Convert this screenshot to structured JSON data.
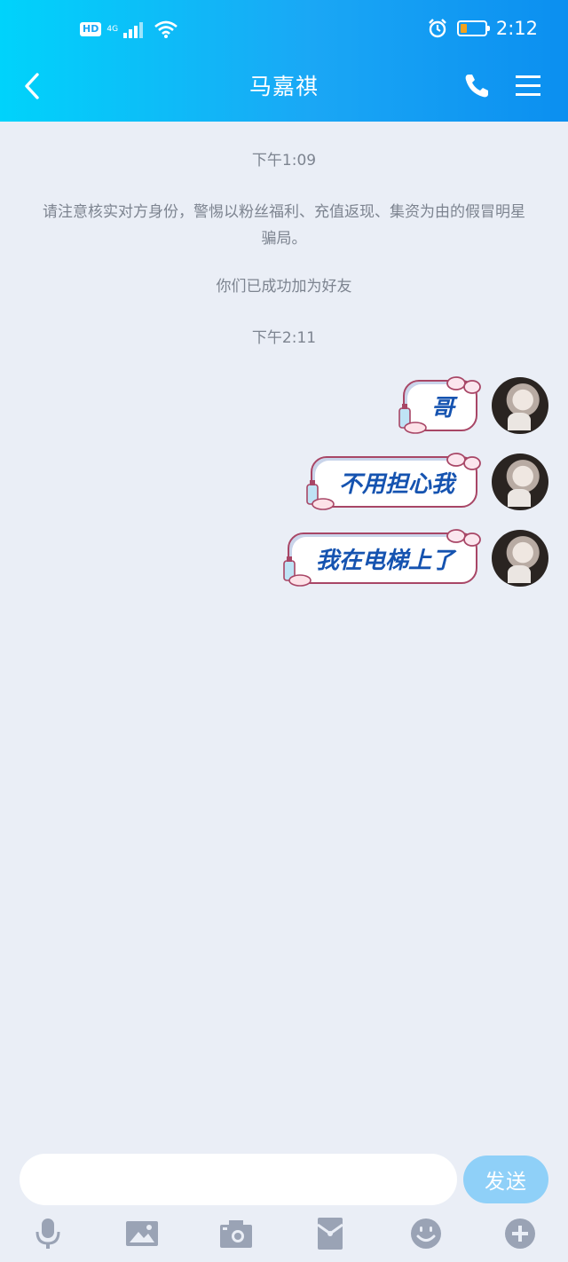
{
  "status_bar": {
    "hd": "HD",
    "network": "4G",
    "time": "2:12",
    "battery_level": 0.25,
    "battery_color": "#f6a21c"
  },
  "nav": {
    "title": "马嘉祺",
    "back_icon": "chevron-left-icon",
    "call_icon": "phone-icon",
    "menu_icon": "menu-icon"
  },
  "messages": {
    "system": [
      {
        "type": "time",
        "text": "下午1:09"
      },
      {
        "type": "notice",
        "text": "请注意核实对方身份，警惕以粉丝福利、充值返现、集资为由的假冒明星骗局。"
      },
      {
        "type": "notice",
        "text": "你们已成功加为好友"
      },
      {
        "type": "time",
        "text": "下午2:11"
      }
    ],
    "outgoing": [
      {
        "text": "哥"
      },
      {
        "text": "不用担心我"
      },
      {
        "text": "我在电梯上了"
      }
    ]
  },
  "composer": {
    "input_value": "",
    "send_label": "发送"
  },
  "toolbar": {
    "items": [
      "microphone-icon",
      "image-icon",
      "camera-icon",
      "red-packet-icon",
      "emoji-icon",
      "plus-icon"
    ]
  },
  "colors": {
    "header_start": "#00d3fb",
    "header_end": "#0b8ff0",
    "background": "#eaeef6",
    "bubble_text": "#1553b0",
    "bubble_border": "#a84666",
    "send_button": "#8fd0f8"
  }
}
